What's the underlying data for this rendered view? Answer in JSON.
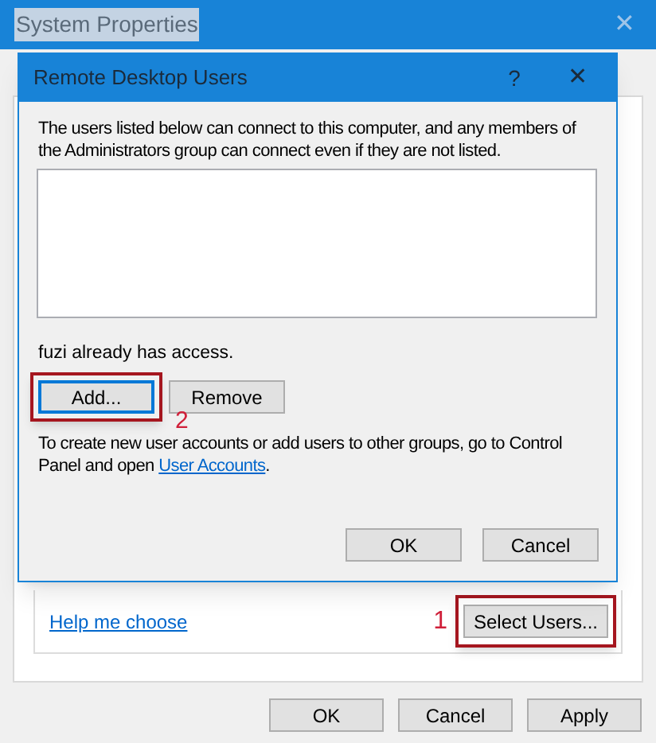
{
  "window": {
    "title": "System Properties",
    "close": "✕"
  },
  "outer": {
    "help_link": "Help me choose",
    "select_users_annotation": "1",
    "select_users_button": "Select Users...",
    "buttons": [
      "OK",
      "Cancel",
      "Apply"
    ]
  },
  "dialog": {
    "title": "Remote Desktop Users",
    "help": "?",
    "close": "✕",
    "intro": "The users listed below can connect to this computer, and any members of the Administrators group can connect even if they are not listed.",
    "access_note": "fuzi already has access.",
    "add_button": "Add...",
    "add_annotation": "2",
    "remove_button": "Remove",
    "info_text": "To create new user accounts or add users to other groups, go to Control Panel and open ",
    "info_link": "User Accounts",
    "info_end": ".",
    "buttons": [
      "OK",
      "Cancel"
    ]
  }
}
